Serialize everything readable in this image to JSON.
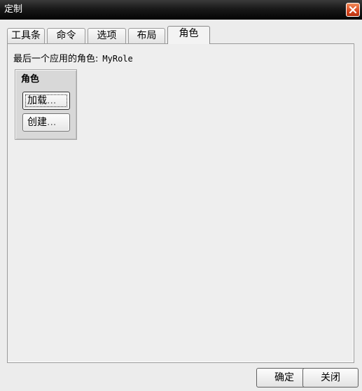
{
  "window": {
    "title": "定制"
  },
  "tabs": [
    {
      "label": "工具条",
      "active": false
    },
    {
      "label": "命令",
      "active": false
    },
    {
      "label": "选项",
      "active": false
    },
    {
      "label": "布局",
      "active": false
    },
    {
      "label": "角色",
      "active": true
    }
  ],
  "panel": {
    "last_role_label": "最后一个应用的角色:",
    "last_role_value": "MyRole",
    "group_title": "角色",
    "load_button": {
      "label": "加载",
      "suffix": "..."
    },
    "create_button": {
      "label": "创建",
      "suffix": "..."
    }
  },
  "footer": {
    "ok_label": "确定",
    "close_label": "关闭"
  }
}
